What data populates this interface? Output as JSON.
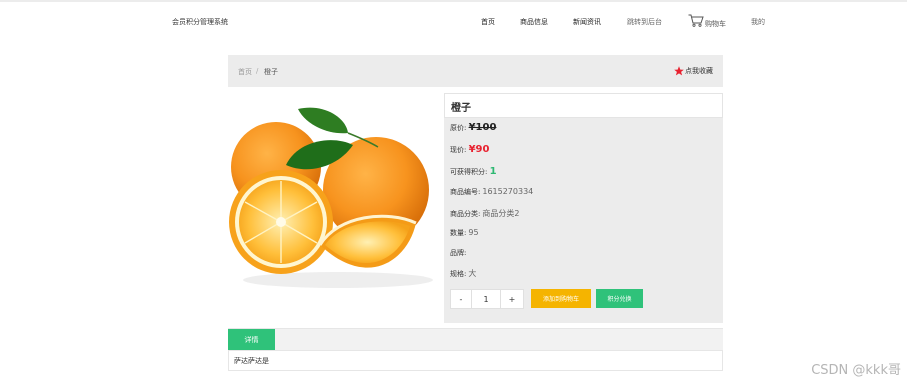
{
  "header": {
    "site_title": "会员积分管理系统",
    "nav": [
      "首页",
      "商品信息",
      "新闻资讯",
      "跳转到后台"
    ],
    "cart_label": "购物车",
    "me_label": "我的"
  },
  "breadcrumb": {
    "home": "首页",
    "separator": "/",
    "current": "橙子",
    "favorite_label": "点我收藏"
  },
  "product": {
    "name": "橙子",
    "original_price_label": "原价:",
    "original_price": "¥100",
    "current_price_label": "现价:",
    "current_price": "¥90",
    "points_label": "可获得积分:",
    "points": "1",
    "code_label": "商品编号:",
    "code": "1615270334",
    "category_label": "商品分类:",
    "category": "商品分类2",
    "quantity_label": "数量:",
    "quantity": "95",
    "brand_label": "品牌:",
    "brand": "",
    "spec_label": "规格:",
    "spec": "大"
  },
  "purchase": {
    "minus": "-",
    "qty": "1",
    "plus": "+",
    "add_to_cart": "添加到购物车",
    "exchange": "积分兑换"
  },
  "tabs": {
    "active": "详情",
    "content": "萨达萨达是"
  },
  "watermark": "CSDN @kkk哥",
  "colors": {
    "green": "#2fc27a",
    "yellow": "#f5b400",
    "price_red": "#e8212f",
    "panel_gray": "#ececec"
  }
}
